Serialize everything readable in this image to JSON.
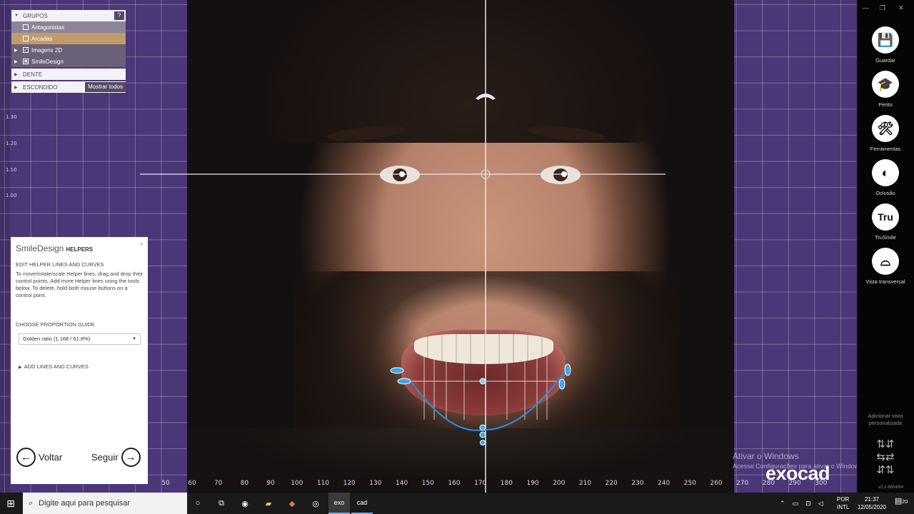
{
  "tree": {
    "header": "GRUPOS",
    "help": "?",
    "items": [
      {
        "label": "Antagonistas",
        "checked": false
      },
      {
        "label": "Arcadas",
        "checked": false
      },
      {
        "label": "Imagens 2D",
        "checked": true
      },
      {
        "label": "SmileDesign",
        "checked": true
      }
    ],
    "dente": "DENTE",
    "escondido": "ESCONDIDO",
    "show_all": "Mostrar todos"
  },
  "smiledesign": {
    "title": "SmileDesign",
    "title_suffix": "HELPERS",
    "close": "×",
    "edit_title": "EDIT HELPER LINES AND CURVES",
    "description": "To move/rotate/scale Helper lines, drag and drop their control points. Add more Helper lines using the tools below. To delete, hold both mouse buttons on a control point.",
    "guide_label": "CHOOSE PROPORTION GUIDE",
    "guide_value": "Golden ratio (1.168 / 61.8%)",
    "add_lines": "ADD LINES AND CURVES",
    "back": "Voltar",
    "next": "Seguir"
  },
  "toolbar": {
    "tools": [
      {
        "label": "Guardar",
        "icon": "save-icon",
        "glyph": "💾"
      },
      {
        "label": "Perito",
        "icon": "graduation-cap-icon",
        "glyph": "🎓"
      },
      {
        "label": "Ferramentas",
        "icon": "tools-icon",
        "glyph": "🛠"
      },
      {
        "label": "Oclusão",
        "icon": "occlusion-icon",
        "glyph": "◐"
      },
      {
        "label": "TruSmile",
        "icon": "trusmile-icon",
        "glyph": "Tru"
      },
      {
        "label": "Vista transversal",
        "icon": "cross-section-icon",
        "glyph": "⌓"
      }
    ],
    "custom_view": "Adicionar vista personalizada",
    "version": "v2.2-6654/64"
  },
  "ruler_bottom": [
    "60",
    "70",
    "80",
    "90",
    "100",
    "110",
    "120",
    "130",
    "140",
    "150",
    "160",
    "170",
    "180",
    "190",
    "200",
    "210",
    "220",
    "230",
    "240",
    "250",
    "260",
    "270",
    "280",
    "290",
    "300"
  ],
  "ruler_bottom_left": "50",
  "watermark": {
    "line1": "Ativar o Windows",
    "line2": "Acesse Configurações para ativar o Windows."
  },
  "brand": "exocad",
  "taskbar": {
    "search_placeholder": "Digite aqui para pesquisar",
    "app1": "exo",
    "app2": "cad",
    "lang1": "POR",
    "lang2": "INTL",
    "time": "21:37",
    "date": "12/05/2020",
    "notif_count": "20"
  },
  "colors": {
    "workspace": "#4b3677",
    "helper_curve": "#2d8ad6",
    "helper_point": "#3da8e8"
  }
}
